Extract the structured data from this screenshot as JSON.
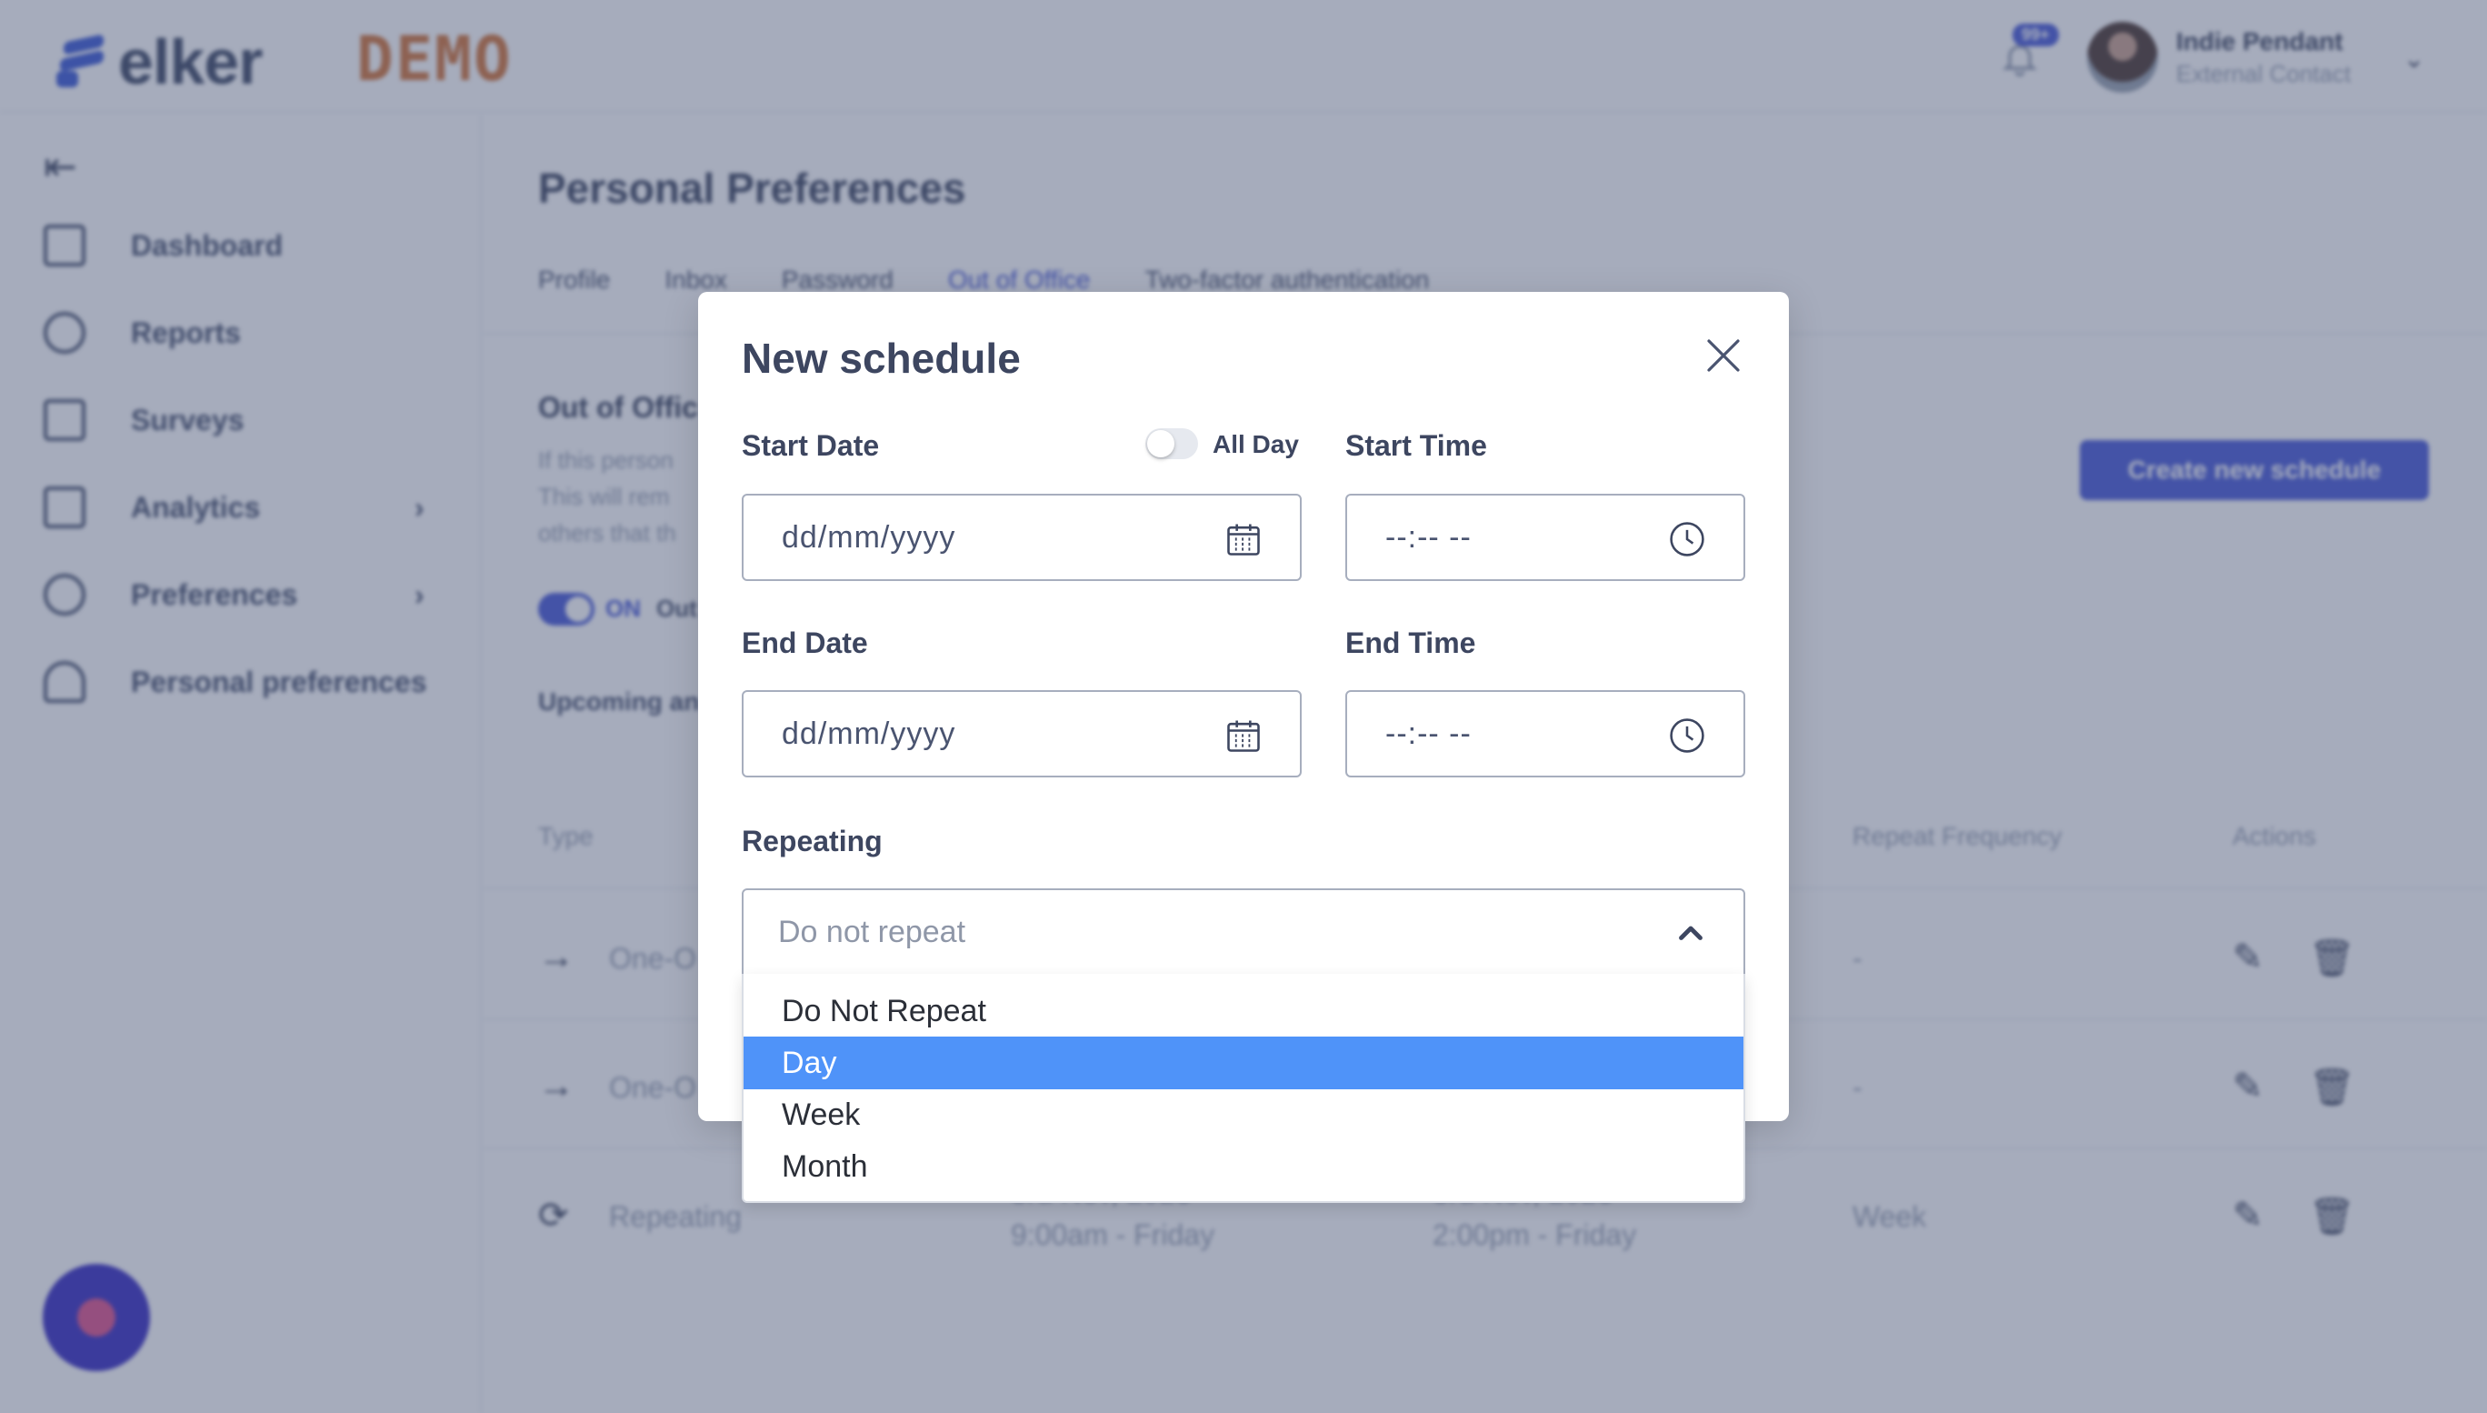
{
  "brand": {
    "logo_text": "elker",
    "demo_badge": "DEMO"
  },
  "header": {
    "notification_count": "99+",
    "user_name": "Indie Pendant",
    "user_role": "External Contact"
  },
  "sidebar": {
    "items": [
      {
        "label": "Dashboard",
        "icon": "dashboard-icon"
      },
      {
        "label": "Reports",
        "icon": "reports-icon"
      },
      {
        "label": "Surveys",
        "icon": "surveys-icon"
      },
      {
        "label": "Analytics",
        "icon": "analytics-icon",
        "has_submenu": true
      },
      {
        "label": "Preferences",
        "icon": "gear-icon",
        "has_submenu": true
      },
      {
        "label": "Personal preferences",
        "icon": "user-icon"
      }
    ]
  },
  "page": {
    "title": "Personal Preferences",
    "tabs": [
      "Profile",
      "Inbox",
      "Password",
      "Out of Office",
      "Two-factor authentication"
    ],
    "active_tab": "Out of Office",
    "ooo_title": "Out of Offic",
    "ooo_desc": [
      "If this person",
      "This will rem",
      "others that th"
    ],
    "create_button": "Create new schedule",
    "toggle_on_label": "ON",
    "toggle_text": "Out",
    "upcoming_label": "Upcoming an",
    "table": {
      "headers": {
        "type": "Type",
        "repeat_frequency": "Repeat Frequency",
        "actions": "Actions"
      },
      "rows": [
        {
          "type": "One-O",
          "frequency": "-",
          "start": "",
          "end": ""
        },
        {
          "type": "One-O",
          "frequency": "-",
          "start": "",
          "end": ""
        },
        {
          "type": "Repeating",
          "frequency": "Week",
          "start_date": "3rd Nov, 2023",
          "start": "9:00am - Friday",
          "end_date": "3rd Nov, 2023",
          "end": "2:00pm - Friday"
        }
      ]
    }
  },
  "modal": {
    "title": "New schedule",
    "start_date_label": "Start Date",
    "all_day_label": "All Day",
    "all_day_on": false,
    "start_time_label": "Start Time",
    "start_date_placeholder": "dd/mm/yyyy",
    "start_time_placeholder": "--:-- --",
    "end_date_label": "End Date",
    "end_time_label": "End Time",
    "end_date_placeholder": "dd/mm/yyyy",
    "end_time_placeholder": "--:-- --",
    "repeating_label": "Repeating",
    "repeating_value": "Do not repeat",
    "options": [
      "Do Not Repeat",
      "Day",
      "Week",
      "Month"
    ],
    "highlighted_option": "Day"
  },
  "colors": {
    "accent": "#4a5bd8",
    "dropdown_highlight": "#4f93f9",
    "overlay": "#3e4a6e"
  }
}
